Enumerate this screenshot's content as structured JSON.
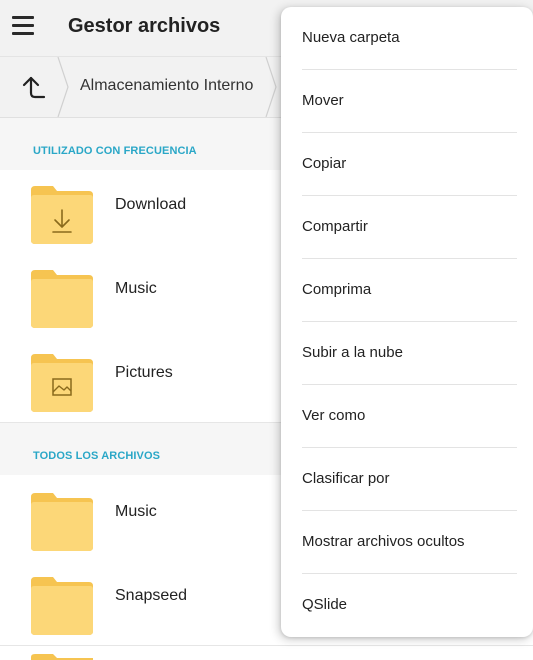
{
  "app": {
    "title": "Gestor archivos"
  },
  "breadcrumb": {
    "up_icon": "arrow-up-icon",
    "current": "Almacenamiento Interno"
  },
  "frequent": {
    "header": "UTILIZADO CON FRECUENCIA",
    "items": [
      {
        "label": "Download",
        "icon": "folder-download-icon"
      },
      {
        "label": "Music",
        "icon": "folder-icon"
      },
      {
        "label": "Pictures",
        "icon": "folder-image-icon"
      }
    ]
  },
  "all_files": {
    "header": "TODOS LOS ARCHIVOS",
    "items": [
      {
        "label": "Music",
        "icon": "folder-icon"
      },
      {
        "label": "Snapseed",
        "icon": "folder-icon"
      }
    ]
  },
  "overflow_menu": {
    "items": [
      {
        "label": "Nueva carpeta"
      },
      {
        "label": "Mover"
      },
      {
        "label": "Copiar"
      },
      {
        "label": "Compartir"
      },
      {
        "label": "Comprima"
      },
      {
        "label": "Subir a la nube"
      },
      {
        "label": "Ver como"
      },
      {
        "label": "Clasificar por"
      },
      {
        "label": "Mostrar archivos ocultos"
      },
      {
        "label": "QSlide"
      }
    ]
  },
  "colors": {
    "accent": "#2aa7c7",
    "folder": "#fcd778",
    "folder_dark": "#f6c451",
    "bar_bg": "#f2f2f2"
  }
}
